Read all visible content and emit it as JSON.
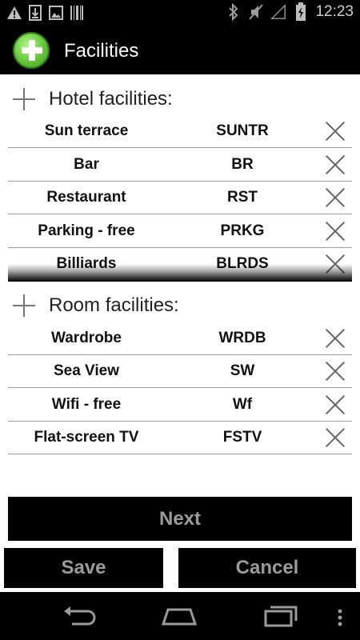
{
  "status_bar": {
    "time": "12:23",
    "left_icons": [
      "warning-icon",
      "download-icon",
      "image-icon",
      "barcode-icon"
    ],
    "right_icons": [
      "bluetooth-icon",
      "mute-icon",
      "signal-icon",
      "battery-charging-icon"
    ]
  },
  "action_bar": {
    "title": "Facilities",
    "icon": "add-circle-icon"
  },
  "hotel_section": {
    "title": "Hotel facilities:",
    "items": [
      {
        "name": "Sun terrace",
        "code": "SUNTR"
      },
      {
        "name": "Bar",
        "code": "BR"
      },
      {
        "name": "Restaurant",
        "code": "RST"
      },
      {
        "name": "Parking - free",
        "code": "PRKG"
      },
      {
        "name": "Billiards",
        "code": "BLRDS"
      }
    ]
  },
  "room_section": {
    "title": "Room facilities:",
    "items": [
      {
        "name": "Wardrobe",
        "code": "WRDB"
      },
      {
        "name": "Sea View",
        "code": "SW"
      },
      {
        "name": "Wifi - free",
        "code": "Wf"
      },
      {
        "name": "Flat-screen TV",
        "code": "FSTV"
      }
    ]
  },
  "buttons": {
    "next": "Next",
    "save": "Save",
    "cancel": "Cancel"
  },
  "nav_bar": {
    "icons": [
      "back-icon",
      "home-icon",
      "recent-apps-icon",
      "overflow-menu-icon"
    ]
  },
  "colors": {
    "button_bg": "#000000",
    "button_text": "#9b9b9b",
    "app_icon": "#66c53a"
  }
}
